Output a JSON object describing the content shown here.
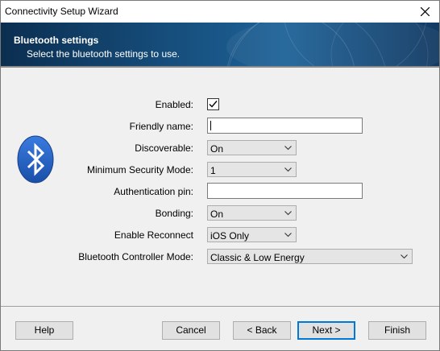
{
  "window": {
    "title": "Connectivity Setup Wizard"
  },
  "banner": {
    "title": "Bluetooth settings",
    "subtitle": "Select the bluetooth settings to use."
  },
  "form": {
    "enabled": {
      "label": "Enabled:",
      "checked": true
    },
    "friendly_name": {
      "label": "Friendly name:",
      "value": ""
    },
    "discoverable": {
      "label": "Discoverable:",
      "value": "On"
    },
    "min_security": {
      "label": "Minimum Security Mode:",
      "value": "1"
    },
    "auth_pin": {
      "label": "Authentication pin:",
      "value": ""
    },
    "bonding": {
      "label": "Bonding:",
      "value": "On"
    },
    "enable_reconnect": {
      "label": "Enable Reconnect",
      "value": "iOS Only"
    },
    "controller_mode": {
      "label": "Bluetooth Controller Mode:",
      "value": "Classic & Low Energy"
    }
  },
  "buttons": {
    "help": "Help",
    "cancel": "Cancel",
    "back": "< Back",
    "next": "Next >",
    "finish": "Finish"
  },
  "colors": {
    "banner": "#154b78",
    "bluetooth_blue": "#1f5fc0",
    "focus": "#0078d7"
  },
  "icons": {
    "close": "close-icon",
    "bluetooth": "bluetooth-icon",
    "check": "checkmark-icon",
    "dropdown": "chevron-down-icon"
  }
}
